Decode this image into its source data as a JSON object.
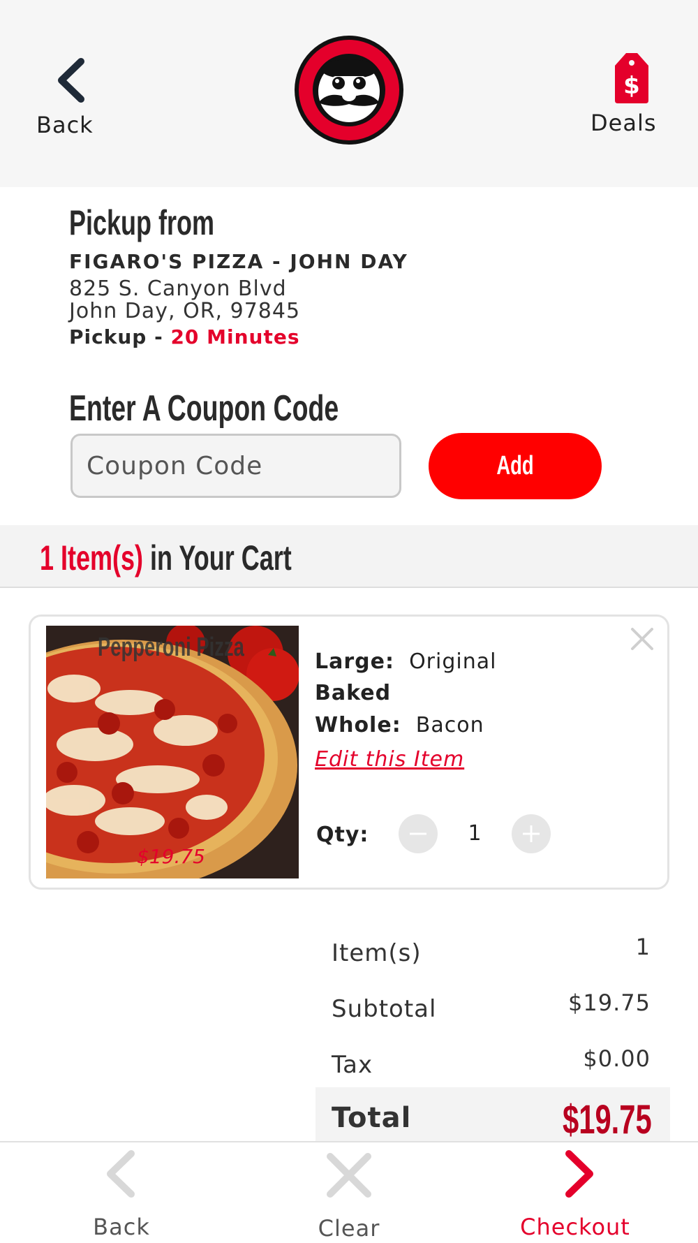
{
  "header": {
    "back_label": "Back",
    "deals_label": "Deals",
    "logo_icon": "figaros-mustache-logo"
  },
  "pickup": {
    "heading": "Pickup from",
    "store_name": "FIGARO'S PIZZA - JOHN DAY",
    "address_line1": "825 S. Canyon Blvd",
    "address_line2": "John Day, OR, 97845",
    "pickup_prefix": "Pickup - ",
    "pickup_time": "20 Minutes"
  },
  "coupon": {
    "heading": "Enter A Coupon Code",
    "placeholder": "Coupon Code",
    "add_label": "Add"
  },
  "cart": {
    "count_red": "1 Item(s)",
    "count_rest": " in Your Cart",
    "items": [
      {
        "title": "Pepperoni Pizza",
        "price": "$19.75",
        "size_label": "Large:",
        "size_value": "Original",
        "crust": "Baked",
        "topping_label": "Whole:",
        "topping_value": "Bacon",
        "edit_label": "Edit this Item",
        "qty_label": "Qty:",
        "qty": "1"
      }
    ]
  },
  "summary": {
    "items_label": "Item(s)",
    "items_value": "1",
    "subtotal_label": "Subtotal",
    "subtotal_value": "$19.75",
    "tax_label": "Tax",
    "tax_value": "$0.00",
    "total_label": "Total",
    "total_value": "$19.75"
  },
  "bottom_nav": {
    "back_label": "Back",
    "clear_label": "Clear",
    "checkout_label": "Checkout"
  },
  "colors": {
    "brand_red": "#e4002b",
    "button_red": "#ff0000",
    "total_red": "#b8001f"
  }
}
